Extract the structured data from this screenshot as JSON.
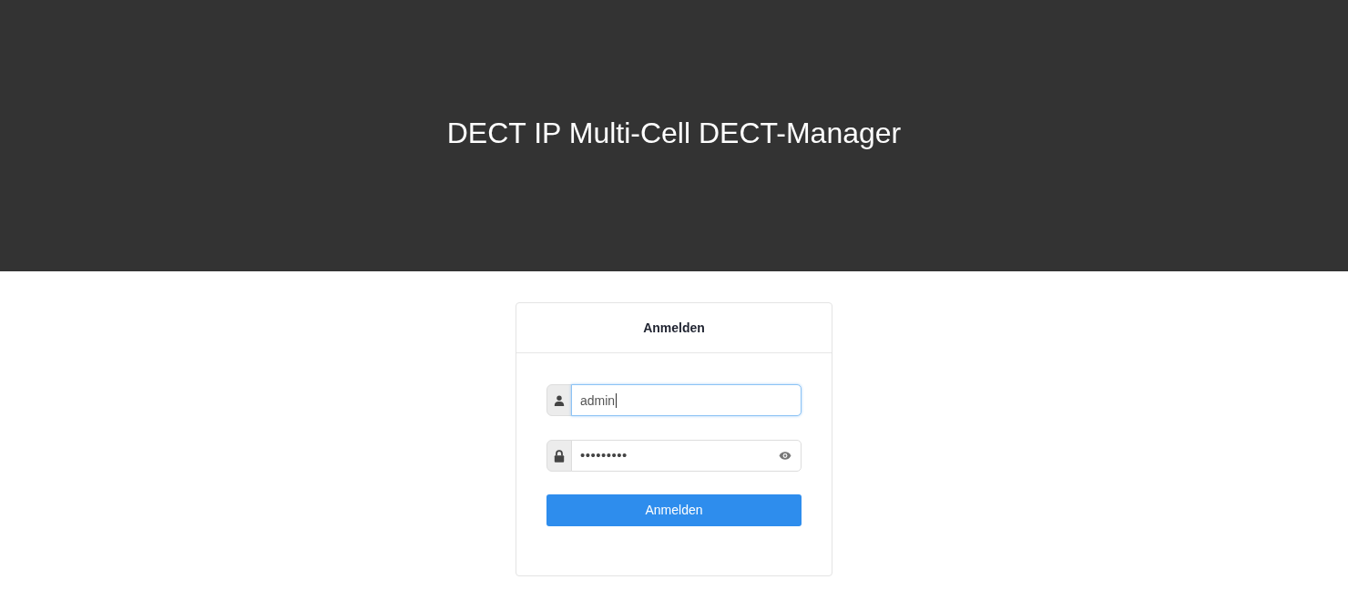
{
  "header": {
    "title": "DECT IP Multi-Cell DECT-Manager"
  },
  "login_card": {
    "title": "Anmelden",
    "fields": [
      {
        "kind": "username",
        "value": "admin",
        "focused": true
      },
      {
        "kind": "password",
        "value": "•••••••••",
        "focused": false
      }
    ],
    "submit_button": "Anmelden"
  }
}
